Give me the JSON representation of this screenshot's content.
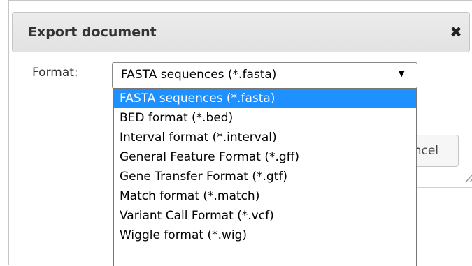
{
  "dialog": {
    "title": "Export document",
    "close_label": "✖",
    "cancel_label": "Cancel"
  },
  "format": {
    "label": "Format:",
    "selected": "FASTA sequences (*.fasta)",
    "arrow": "▼",
    "options": [
      "FASTA sequences (*.fasta)",
      "BED format (*.bed)",
      "Interval format (*.interval)",
      "General Feature Format (*.gff)",
      "Gene Transfer Format (*.gtf)",
      "Match format (*.match)",
      "Variant Call Format (*.vcf)",
      "Wiggle format (*.wig)"
    ],
    "highlighted_index": 0
  },
  "colors": {
    "highlight": "#1e90ff",
    "titlebar": "#e8e8e8"
  }
}
